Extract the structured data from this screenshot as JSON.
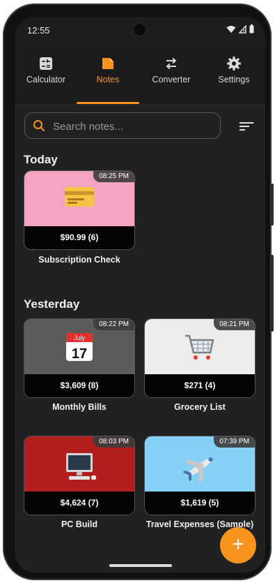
{
  "status": {
    "time": "12:55"
  },
  "tabs": [
    {
      "label": "Calculator",
      "icon": "calculator-icon"
    },
    {
      "label": "Notes",
      "icon": "notes-icon"
    },
    {
      "label": "Converter",
      "icon": "converter-icon"
    },
    {
      "label": "Settings",
      "icon": "settings-icon"
    }
  ],
  "active_tab": "Notes",
  "search": {
    "placeholder": "Search notes..."
  },
  "sections": [
    {
      "title": "Today",
      "notes": [
        {
          "name": "Subscription Check",
          "amount": "$90.99 (6)",
          "time": "08:25 PM",
          "icon": "credit-card-icon",
          "bg": "#f4a3c2"
        }
      ]
    },
    {
      "title": "Yesterday",
      "notes": [
        {
          "name": "Monthly Bills",
          "amount": "$3,609 (8)",
          "time": "08:22 PM",
          "icon": "calendar-icon",
          "bg": "#5b5b5b",
          "calendar_month": "July",
          "calendar_day": "17"
        },
        {
          "name": "Grocery List",
          "amount": "$271 (4)",
          "time": "08:21 PM",
          "icon": "shopping-cart-icon",
          "bg": "#ececec"
        },
        {
          "name": "PC Build",
          "amount": "$4,624 (7)",
          "time": "08:03 PM",
          "icon": "computer-icon",
          "bg": "#b21d1d"
        },
        {
          "name": "Travel Expenses (Sample)",
          "amount": "$1,619 (5)",
          "time": "07:39 PM",
          "icon": "airplane-icon",
          "bg": "#86d0f5"
        }
      ]
    }
  ],
  "fab": {
    "label": "+"
  },
  "colors": {
    "accent": "#f7941d",
    "background": "#212121"
  }
}
